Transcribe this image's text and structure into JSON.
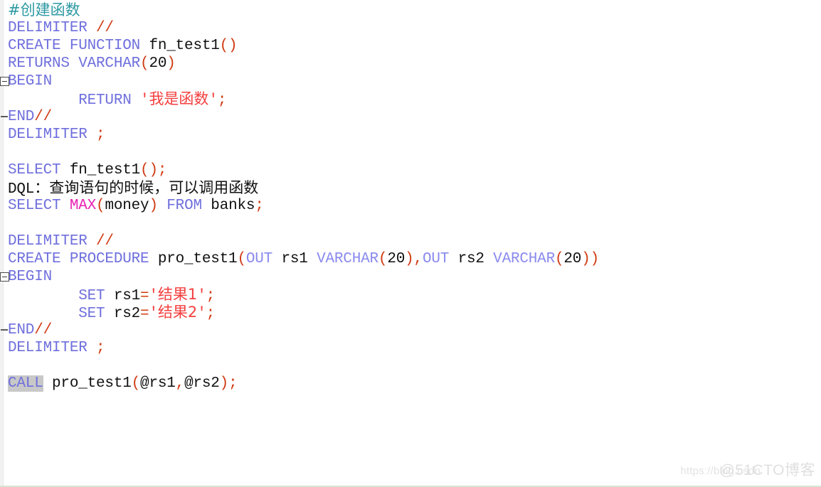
{
  "editor": {
    "language": "SQL",
    "background": "#ffffff",
    "bottom_border_color": "#d7e7d2",
    "gutter_color": "#f2f2f2",
    "selection_color": "#c8c8c8",
    "colors": {
      "keyword": "#6f6fdd",
      "keyword_light": "#8a8aee",
      "builtin_function": "#e91fb4",
      "string": "#f43f3f",
      "punctuation": "#d03a12",
      "identifier": "#101010",
      "comment": "#2f9aa3"
    }
  },
  "lines": [
    {
      "n": 1,
      "fold": "none",
      "tokens": [
        {
          "t": "#创建函数",
          "c": "cmt han"
        }
      ]
    },
    {
      "n": 2,
      "fold": "none",
      "tokens": [
        {
          "t": "DELIMITER ",
          "c": "kw"
        },
        {
          "t": "//",
          "c": "punct"
        }
      ]
    },
    {
      "n": 3,
      "fold": "none",
      "tokens": [
        {
          "t": "CREATE FUNCTION ",
          "c": "kw"
        },
        {
          "t": "fn_test1",
          "c": "ident"
        },
        {
          "t": "()",
          "c": "punct"
        }
      ]
    },
    {
      "n": 4,
      "fold": "none",
      "tokens": [
        {
          "t": "RETURNS VARCHAR",
          "c": "kw"
        },
        {
          "t": "(",
          "c": "punct"
        },
        {
          "t": "20",
          "c": "ident"
        },
        {
          "t": ")",
          "c": "punct"
        }
      ]
    },
    {
      "n": 5,
      "fold": "box",
      "tokens": [
        {
          "t": "BEGIN",
          "c": "kw"
        }
      ]
    },
    {
      "n": 6,
      "fold": "none",
      "tokens": [
        {
          "t": "        RETURN ",
          "c": "kw"
        },
        {
          "t": "'",
          "c": "str"
        },
        {
          "t": "我是函数",
          "c": "str han"
        },
        {
          "t": "'",
          "c": "str"
        },
        {
          "t": ";",
          "c": "punct"
        }
      ]
    },
    {
      "n": 7,
      "fold": "end",
      "tokens": [
        {
          "t": "END",
          "c": "kw"
        },
        {
          "t": "//",
          "c": "punct"
        }
      ]
    },
    {
      "n": 8,
      "fold": "none",
      "tokens": [
        {
          "t": "DELIMITER ",
          "c": "kw"
        },
        {
          "t": ";",
          "c": "punct"
        }
      ]
    },
    {
      "n": 9,
      "fold": "none",
      "tokens": []
    },
    {
      "n": 10,
      "fold": "none",
      "tokens": [
        {
          "t": "SELECT ",
          "c": "kw"
        },
        {
          "t": "fn_test1",
          "c": "ident"
        },
        {
          "t": "();",
          "c": "punct"
        }
      ]
    },
    {
      "n": 11,
      "fold": "none",
      "tokens": [
        {
          "t": "DQL",
          "c": "ident"
        },
        {
          "t": "：查询语句的时候，可以调用函数",
          "c": "cn han"
        }
      ]
    },
    {
      "n": 12,
      "fold": "none",
      "tokens": [
        {
          "t": "SELECT ",
          "c": "kw"
        },
        {
          "t": "MAX",
          "c": "fnname"
        },
        {
          "t": "(",
          "c": "punct"
        },
        {
          "t": "money",
          "c": "ident"
        },
        {
          "t": ") ",
          "c": "punct"
        },
        {
          "t": "FROM ",
          "c": "kw"
        },
        {
          "t": "banks",
          "c": "ident"
        },
        {
          "t": ";",
          "c": "punct"
        }
      ]
    },
    {
      "n": 13,
      "fold": "none",
      "tokens": []
    },
    {
      "n": 14,
      "fold": "none",
      "tokens": [
        {
          "t": "DELIMITER ",
          "c": "kw"
        },
        {
          "t": "//",
          "c": "punct"
        }
      ]
    },
    {
      "n": 15,
      "fold": "none",
      "tokens": [
        {
          "t": "CREATE PROCEDURE ",
          "c": "kw"
        },
        {
          "t": "pro_test1",
          "c": "ident"
        },
        {
          "t": "(",
          "c": "punct"
        },
        {
          "t": "OUT ",
          "c": "kw2"
        },
        {
          "t": "rs1 ",
          "c": "ident"
        },
        {
          "t": "VARCHAR",
          "c": "kw2"
        },
        {
          "t": "(",
          "c": "punct"
        },
        {
          "t": "20",
          "c": "ident"
        },
        {
          "t": "),",
          "c": "punct"
        },
        {
          "t": "OUT ",
          "c": "kw2"
        },
        {
          "t": "rs2 ",
          "c": "ident"
        },
        {
          "t": "VARCHAR",
          "c": "kw2"
        },
        {
          "t": "(",
          "c": "punct"
        },
        {
          "t": "20",
          "c": "ident"
        },
        {
          "t": "))",
          "c": "punct"
        }
      ]
    },
    {
      "n": 16,
      "fold": "box",
      "tokens": [
        {
          "t": "BEGIN",
          "c": "kw"
        }
      ]
    },
    {
      "n": 17,
      "fold": "none",
      "tokens": [
        {
          "t": "        SET ",
          "c": "kw"
        },
        {
          "t": "rs1",
          "c": "ident"
        },
        {
          "t": "=",
          "c": "punct"
        },
        {
          "t": "'",
          "c": "str"
        },
        {
          "t": "结果1",
          "c": "str han"
        },
        {
          "t": "'",
          "c": "str"
        },
        {
          "t": ";",
          "c": "punct"
        }
      ]
    },
    {
      "n": 18,
      "fold": "none",
      "tokens": [
        {
          "t": "        SET ",
          "c": "kw"
        },
        {
          "t": "rs2",
          "c": "ident"
        },
        {
          "t": "=",
          "c": "punct"
        },
        {
          "t": "'",
          "c": "str"
        },
        {
          "t": "结果2",
          "c": "str han"
        },
        {
          "t": "'",
          "c": "str"
        },
        {
          "t": ";",
          "c": "punct"
        }
      ]
    },
    {
      "n": 19,
      "fold": "end",
      "tokens": [
        {
          "t": "END",
          "c": "kw"
        },
        {
          "t": "//",
          "c": "punct"
        }
      ]
    },
    {
      "n": 20,
      "fold": "none",
      "tokens": [
        {
          "t": "DELIMITER ",
          "c": "kw"
        },
        {
          "t": ";",
          "c": "punct"
        }
      ]
    },
    {
      "n": 21,
      "fold": "none",
      "tokens": []
    },
    {
      "n": 22,
      "fold": "none",
      "tokens": [
        {
          "t": "CALL",
          "c": "kw sel"
        },
        {
          "t": " ",
          "c": "ident"
        },
        {
          "t": "pro_test1",
          "c": "ident"
        },
        {
          "t": "(",
          "c": "punct"
        },
        {
          "t": "@rs1",
          "c": "ident"
        },
        {
          "t": ",",
          "c": "punct"
        },
        {
          "t": "@rs2",
          "c": "ident"
        },
        {
          "t": ");",
          "c": "punct"
        }
      ]
    }
  ],
  "watermarks": {
    "csdn": "https://blog.csdn",
    "cto": "@51CTO博客"
  }
}
